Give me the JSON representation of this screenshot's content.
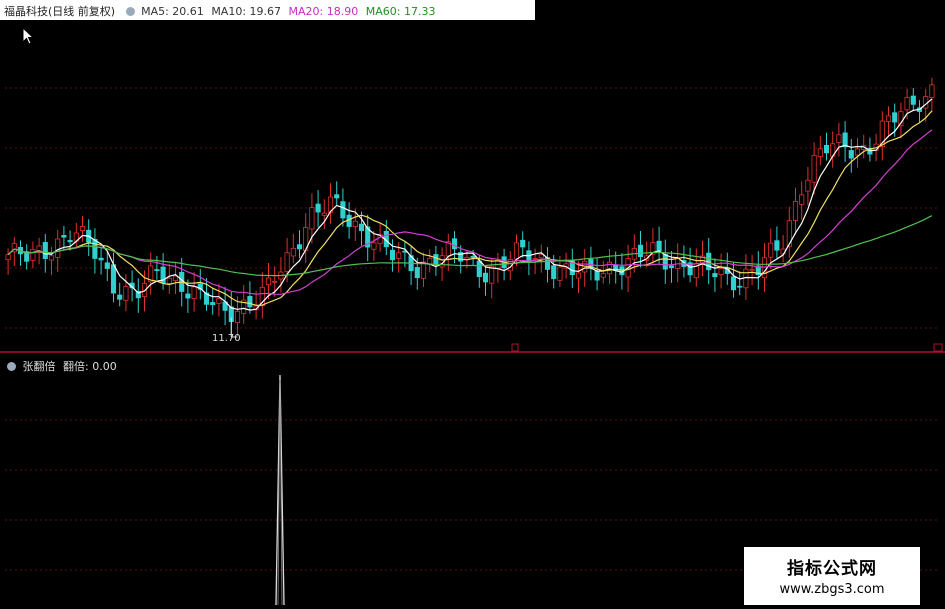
{
  "header": {
    "stock_name": "福晶科技(日线 前复权)",
    "ma5": "MA5: 20.61",
    "ma10": "MA10: 19.67",
    "ma20": "MA20: 18.90",
    "ma60": "MA60: 17.33"
  },
  "colors": {
    "ma5": "#ffffff",
    "ma10": "#f0e060",
    "ma20": "#d040d0",
    "ma60": "#50c050",
    "up": "#e03030",
    "down": "#30d0d0",
    "divider": "#b01030",
    "grid": "#5a1010"
  },
  "low_marker": "11.70",
  "indicator": {
    "name": "张翻倍",
    "value_label": "翻倍: 0.00"
  },
  "watermark": {
    "title": "指标公式网",
    "url": "www.zbgs3.com"
  },
  "chart_data": [
    {
      "type": "candlestick",
      "title": "福晶科技(日线 前复权)",
      "low_annotation": 11.7,
      "ma_latest": {
        "MA5": 20.61,
        "MA10": 19.67,
        "MA20": 18.9,
        "MA60": 17.33
      },
      "close_trend": [
        14.2,
        14.0,
        14.6,
        15.1,
        14.3,
        13.0,
        12.6,
        13.5,
        13.2,
        12.4,
        11.9,
        12.3,
        12.6,
        14.0,
        15.8,
        16.1,
        15.5,
        14.9,
        14.0,
        13.7,
        14.3,
        14.1,
        13.6,
        13.9,
        14.2,
        14.0,
        13.5,
        13.4,
        13.8,
        13.9,
        14.3,
        14.0,
        13.6,
        13.5,
        13.3,
        13.6,
        14.6,
        17.2,
        18.3,
        18.6,
        18.4,
        19.3,
        20.3,
        20.7
      ]
    },
    {
      "type": "line",
      "title": "张翻倍",
      "value_label": "翻倍: 0.00",
      "spike_position_fraction": 0.3
    }
  ]
}
